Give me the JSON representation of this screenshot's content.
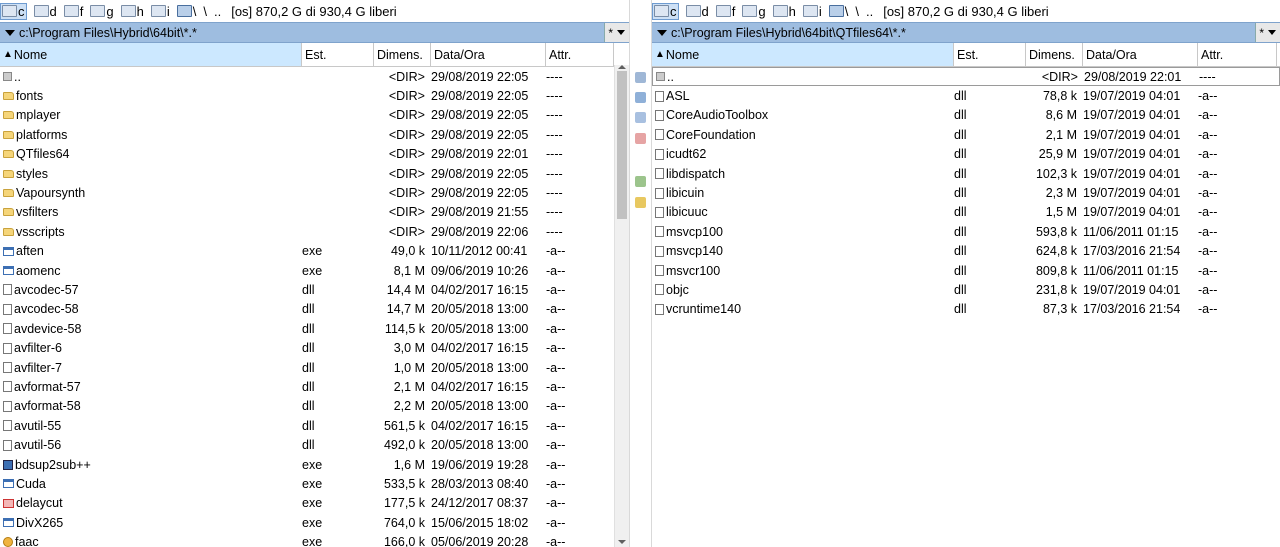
{
  "left": {
    "drives": [
      "c",
      "d",
      "f",
      "g",
      "h",
      "i"
    ],
    "active_drive": "c",
    "net_label": "\\",
    "up_label": "..",
    "drive_info": "[os]  870,2 G di 930,4 G liberi",
    "path": "c:\\Program Files\\Hybrid\\64bit\\*.*",
    "filter_label": "*",
    "columns": {
      "name": "Nome",
      "ext": "Est.",
      "size": "Dimens.",
      "date": "Data/Ora",
      "attr": "Attr."
    },
    "rows": [
      {
        "icon": "updir",
        "name": "..",
        "ext": "",
        "size": "<DIR>",
        "date": "29/08/2019 22:05",
        "attr": "----"
      },
      {
        "icon": "folder",
        "name": "fonts",
        "ext": "",
        "size": "<DIR>",
        "date": "29/08/2019 22:05",
        "attr": "----"
      },
      {
        "icon": "folder",
        "name": "mplayer",
        "ext": "",
        "size": "<DIR>",
        "date": "29/08/2019 22:05",
        "attr": "----"
      },
      {
        "icon": "folder",
        "name": "platforms",
        "ext": "",
        "size": "<DIR>",
        "date": "29/08/2019 22:05",
        "attr": "----"
      },
      {
        "icon": "folder",
        "name": "QTfiles64",
        "ext": "",
        "size": "<DIR>",
        "date": "29/08/2019 22:01",
        "attr": "----"
      },
      {
        "icon": "folder",
        "name": "styles",
        "ext": "",
        "size": "<DIR>",
        "date": "29/08/2019 22:05",
        "attr": "----"
      },
      {
        "icon": "folder",
        "name": "Vapoursynth",
        "ext": "",
        "size": "<DIR>",
        "date": "29/08/2019 22:05",
        "attr": "----"
      },
      {
        "icon": "folder",
        "name": "vsfilters",
        "ext": "",
        "size": "<DIR>",
        "date": "29/08/2019 21:55",
        "attr": "----"
      },
      {
        "icon": "folder",
        "name": "vsscripts",
        "ext": "",
        "size": "<DIR>",
        "date": "29/08/2019 22:06",
        "attr": "----"
      },
      {
        "icon": "exe",
        "name": "aften",
        "ext": "exe",
        "size": "49,0 k",
        "date": "10/11/2012 00:41",
        "attr": "-a--"
      },
      {
        "icon": "exe",
        "name": "aomenc",
        "ext": "exe",
        "size": "8,1 M",
        "date": "09/06/2019 10:26",
        "attr": "-a--"
      },
      {
        "icon": "dll",
        "name": "avcodec-57",
        "ext": "dll",
        "size": "14,4 M",
        "date": "04/02/2017 16:15",
        "attr": "-a--"
      },
      {
        "icon": "dll",
        "name": "avcodec-58",
        "ext": "dll",
        "size": "14,7 M",
        "date": "20/05/2018 13:00",
        "attr": "-a--"
      },
      {
        "icon": "dll",
        "name": "avdevice-58",
        "ext": "dll",
        "size": "114,5 k",
        "date": "20/05/2018 13:00",
        "attr": "-a--"
      },
      {
        "icon": "dll",
        "name": "avfilter-6",
        "ext": "dll",
        "size": "3,0 M",
        "date": "04/02/2017 16:15",
        "attr": "-a--"
      },
      {
        "icon": "dll",
        "name": "avfilter-7",
        "ext": "dll",
        "size": "1,0 M",
        "date": "20/05/2018 13:00",
        "attr": "-a--"
      },
      {
        "icon": "dll",
        "name": "avformat-57",
        "ext": "dll",
        "size": "2,1 M",
        "date": "04/02/2017 16:15",
        "attr": "-a--"
      },
      {
        "icon": "dll",
        "name": "avformat-58",
        "ext": "dll",
        "size": "2,2 M",
        "date": "20/05/2018 13:00",
        "attr": "-a--"
      },
      {
        "icon": "dll",
        "name": "avutil-55",
        "ext": "dll",
        "size": "561,5 k",
        "date": "04/02/2017 16:15",
        "attr": "-a--"
      },
      {
        "icon": "dll",
        "name": "avutil-56",
        "ext": "dll",
        "size": "492,0 k",
        "date": "20/05/2018 13:00",
        "attr": "-a--"
      },
      {
        "icon": "jar",
        "name": "bdsup2sub++",
        "ext": "exe",
        "size": "1,6 M",
        "date": "19/06/2019 19:28",
        "attr": "-a--"
      },
      {
        "icon": "exe",
        "name": "Cuda",
        "ext": "exe",
        "size": "533,5 k",
        "date": "28/03/2013 08:40",
        "attr": "-a--"
      },
      {
        "icon": "red",
        "name": "delaycut",
        "ext": "exe",
        "size": "177,5 k",
        "date": "24/12/2017 08:37",
        "attr": "-a--"
      },
      {
        "icon": "exe",
        "name": "DivX265",
        "ext": "exe",
        "size": "764,0 k",
        "date": "15/06/2015 18:02",
        "attr": "-a--"
      },
      {
        "icon": "star",
        "name": "faac",
        "ext": "exe",
        "size": "166,0 k",
        "date": "05/06/2019 20:28",
        "attr": "-a--"
      }
    ]
  },
  "right": {
    "drives": [
      "c",
      "d",
      "f",
      "g",
      "h",
      "i"
    ],
    "active_drive": "c",
    "net_label": "\\",
    "up_label": "..",
    "drive_info": "[os]  870,2 G di 930,4 G liberi",
    "path": "c:\\Program Files\\Hybrid\\64bit\\QTfiles64\\*.*",
    "filter_label": "*",
    "columns": {
      "name": "Nome",
      "ext": "Est.",
      "size": "Dimens.",
      "date": "Data/Ora",
      "attr": "Attr."
    },
    "rows": [
      {
        "icon": "updir",
        "name": "..",
        "ext": "",
        "size": "<DIR>",
        "date": "29/08/2019 22:01",
        "attr": "----"
      },
      {
        "icon": "dll",
        "name": "ASL",
        "ext": "dll",
        "size": "78,8 k",
        "date": "19/07/2019 04:01",
        "attr": "-a--"
      },
      {
        "icon": "dll",
        "name": "CoreAudioToolbox",
        "ext": "dll",
        "size": "8,6 M",
        "date": "19/07/2019 04:01",
        "attr": "-a--"
      },
      {
        "icon": "dll",
        "name": "CoreFoundation",
        "ext": "dll",
        "size": "2,1 M",
        "date": "19/07/2019 04:01",
        "attr": "-a--"
      },
      {
        "icon": "dll",
        "name": "icudt62",
        "ext": "dll",
        "size": "25,9 M",
        "date": "19/07/2019 04:01",
        "attr": "-a--"
      },
      {
        "icon": "dll",
        "name": "libdispatch",
        "ext": "dll",
        "size": "102,3 k",
        "date": "19/07/2019 04:01",
        "attr": "-a--"
      },
      {
        "icon": "dll",
        "name": "libicuin",
        "ext": "dll",
        "size": "2,3 M",
        "date": "19/07/2019 04:01",
        "attr": "-a--"
      },
      {
        "icon": "dll",
        "name": "libicuuc",
        "ext": "dll",
        "size": "1,5 M",
        "date": "19/07/2019 04:01",
        "attr": "-a--"
      },
      {
        "icon": "dll",
        "name": "msvcp100",
        "ext": "dll",
        "size": "593,8 k",
        "date": "11/06/2011 01:15",
        "attr": "-a--"
      },
      {
        "icon": "dll",
        "name": "msvcp140",
        "ext": "dll",
        "size": "624,8 k",
        "date": "17/03/2016 21:54",
        "attr": "-a--"
      },
      {
        "icon": "dll",
        "name": "msvcr100",
        "ext": "dll",
        "size": "809,8 k",
        "date": "11/06/2011 01:15",
        "attr": "-a--"
      },
      {
        "icon": "dll",
        "name": "objc",
        "ext": "dll",
        "size": "231,8 k",
        "date": "19/07/2019 04:01",
        "attr": "-a--"
      },
      {
        "icon": "dll",
        "name": "vcruntime140",
        "ext": "dll",
        "size": "87,3 k",
        "date": "17/03/2016 21:54",
        "attr": "-a--"
      }
    ]
  },
  "toolbar_mid": [
    "search-icon",
    "view-icon",
    "compare-icon",
    "sync-icon",
    "pack-icon",
    "unpack-icon"
  ]
}
